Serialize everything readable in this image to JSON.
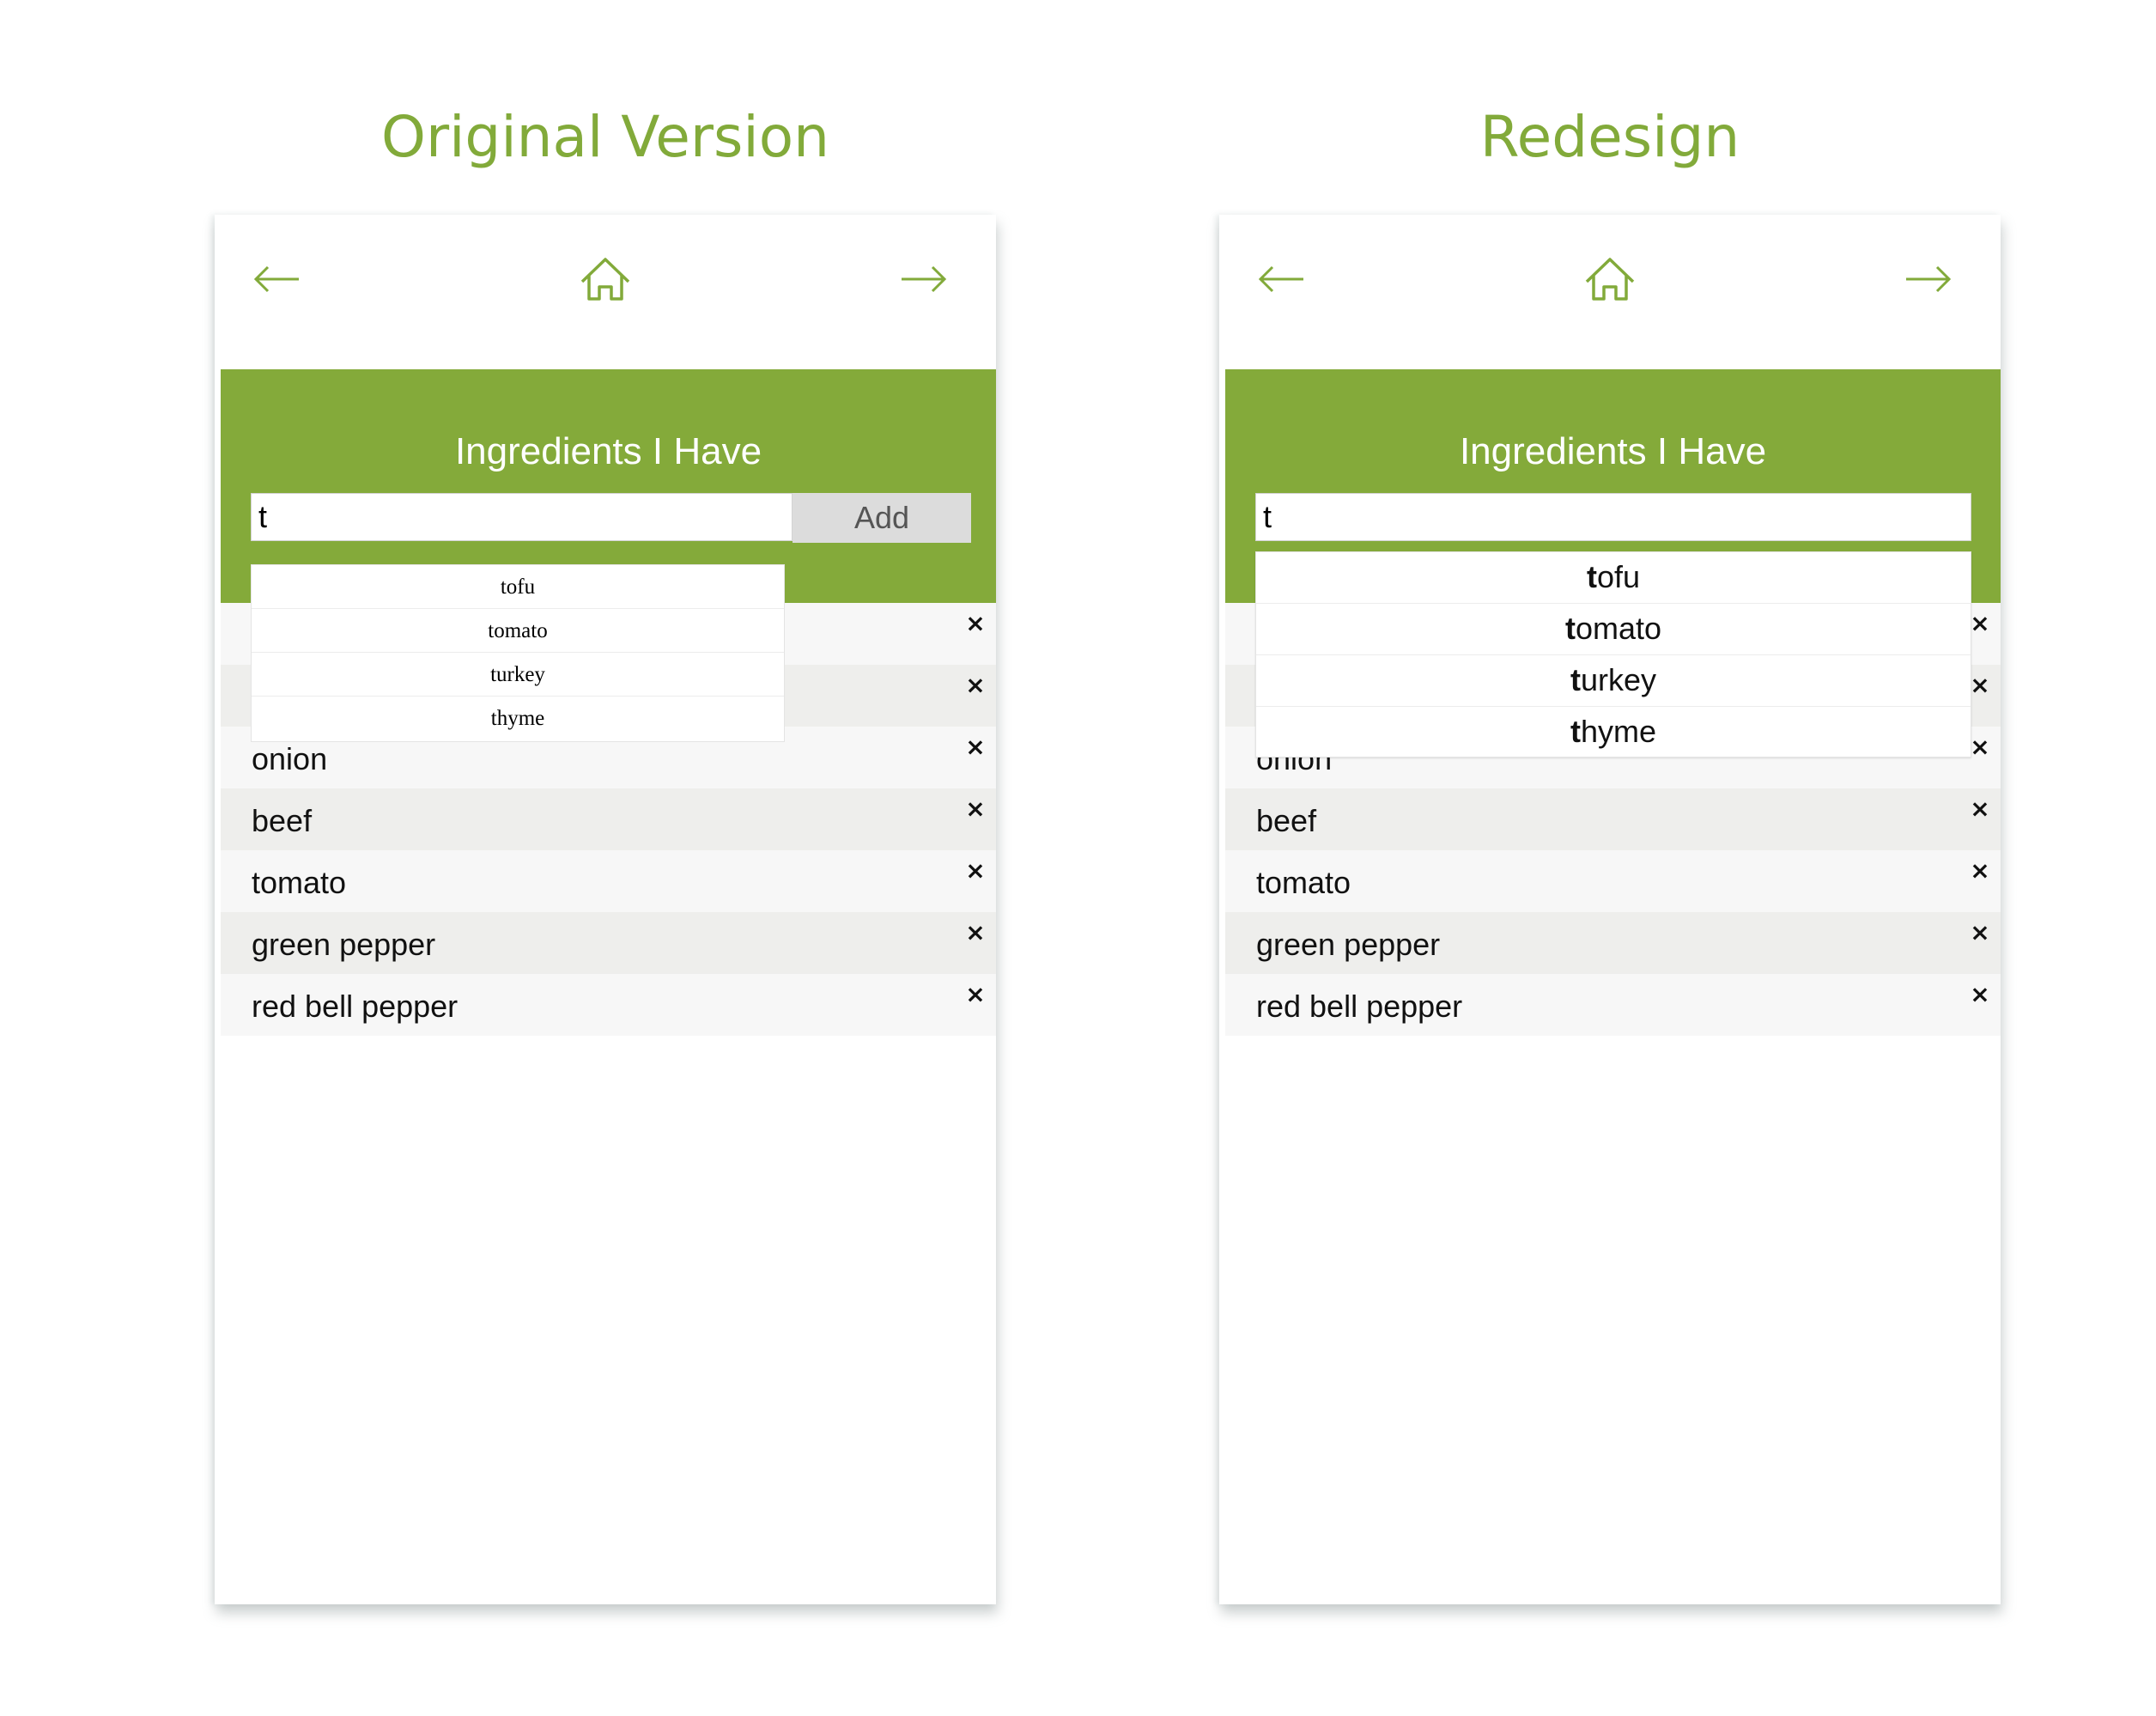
{
  "accent_color": "#84aa3a",
  "icons": {
    "back": "arrow-left-icon",
    "home": "home-icon",
    "forward": "arrow-right-icon",
    "remove": "close-icon"
  },
  "original": {
    "title": "Original Version",
    "panel_heading": "Ingredients I Have",
    "search_value": "t",
    "add_label": "Add",
    "suggestions": [
      "tofu",
      "tomato",
      "turkey",
      "thyme"
    ],
    "ingredients": [
      "",
      "",
      "onion",
      "beef",
      "tomato",
      "green pepper",
      "red bell pepper"
    ],
    "remove_symbol": "×"
  },
  "redesign": {
    "title": "Redesign",
    "panel_heading": "Ingredients I Have",
    "search_value": "t",
    "suggestions": [
      {
        "match": "t",
        "rest": "ofu"
      },
      {
        "match": "t",
        "rest": "omato"
      },
      {
        "match": "t",
        "rest": "urkey"
      },
      {
        "match": "t",
        "rest": "hyme"
      }
    ],
    "ingredients": [
      "",
      "",
      "onion",
      "beef",
      "tomato",
      "green pepper",
      "red bell pepper"
    ],
    "remove_symbol": "×"
  }
}
